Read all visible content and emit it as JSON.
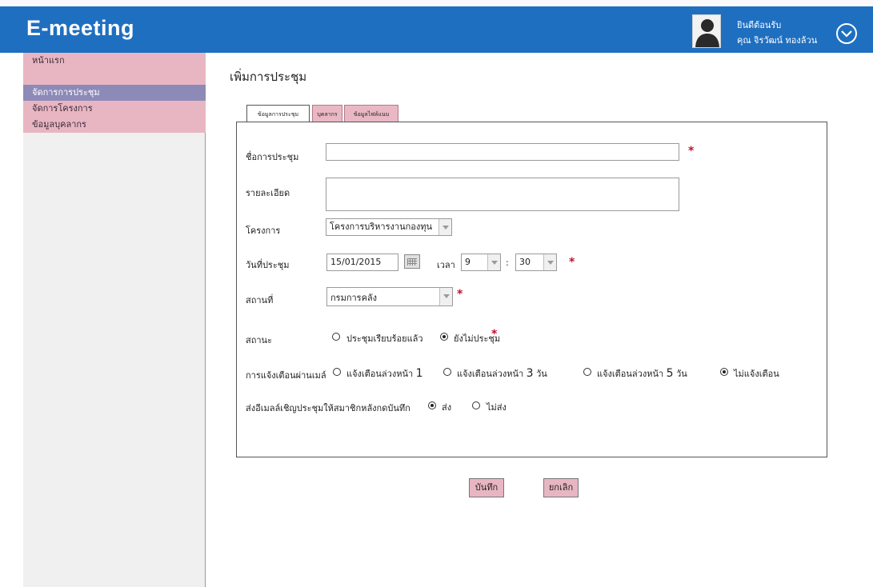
{
  "header": {
    "app_title": "E-meeting",
    "welcome_line1": "ยินดีต้อนรับ",
    "welcome_line2": "คุณ จิรวัฒน์ ทองล้วน"
  },
  "sidebar": {
    "items": [
      {
        "label": "หน้าแรก"
      },
      {
        "label": "จัดการการประชุม"
      },
      {
        "label": "จัดการโครงการ"
      },
      {
        "label": "ข้อมูลบุคลากร"
      }
    ]
  },
  "page": {
    "title": "เพิ่มการประชุม"
  },
  "tabs": [
    {
      "label": "ข้อมูลการประชุม"
    },
    {
      "label": "บุคลากร"
    },
    {
      "label": "ข้อมูลไฟล์แนบ"
    }
  ],
  "form": {
    "meeting_name_label": "ชื่อการประชุม",
    "meeting_name_value": "",
    "detail_label": "รายละเอียด",
    "project_label": "โครงการ",
    "project_value": "โครงการบริหารงานกองทุน",
    "date_label": "วันที่ประชุม",
    "date_value": "15/01/2015",
    "time_label": "เวลา",
    "hour_value": "9",
    "minute_value": "30",
    "time_separator": ":",
    "place_label": "สถานที่",
    "place_value": "กรมการคลัง",
    "status_label": "สถานะ",
    "status_options": [
      "ประชุมเรียบร้อยแล้ว",
      "ยังไม่ประชุม"
    ],
    "status_selected": "ยังไม่ประชุม",
    "email_alert_label": "การแจ้งเตือนผ่านเมล์",
    "alert_options": [
      {
        "prefix": "แจ้งเตือนล่วงหน้า",
        "num": "1",
        "suffix": ""
      },
      {
        "prefix": "แจ้งเตือนล่วงหน้า",
        "num": "3",
        "suffix": "วัน"
      },
      {
        "prefix": "แจ้งเตือนล่วงหน้า",
        "num": "5",
        "suffix": "วัน"
      },
      {
        "prefix": "ไม่แจ้งเตือน",
        "num": "",
        "suffix": ""
      }
    ],
    "alert_selected": "ไม่แจ้งเตือน",
    "send_invite_label": "ส่งอีเมลล์เชิญประชุมให้สมาชิกหลังกดบันทึก",
    "send_options": [
      "ส่ง",
      "ไม่ส่ง"
    ],
    "send_selected": "ส่ง",
    "required_mark": "*"
  },
  "buttons": {
    "save": "บันทึก",
    "cancel": "ยกเลิก"
  },
  "colors": {
    "header": "#1f6fc0",
    "sidebar_pink": "#e8b6c2",
    "sidebar_active": "#8d8ab8",
    "required": "#c0102a"
  }
}
